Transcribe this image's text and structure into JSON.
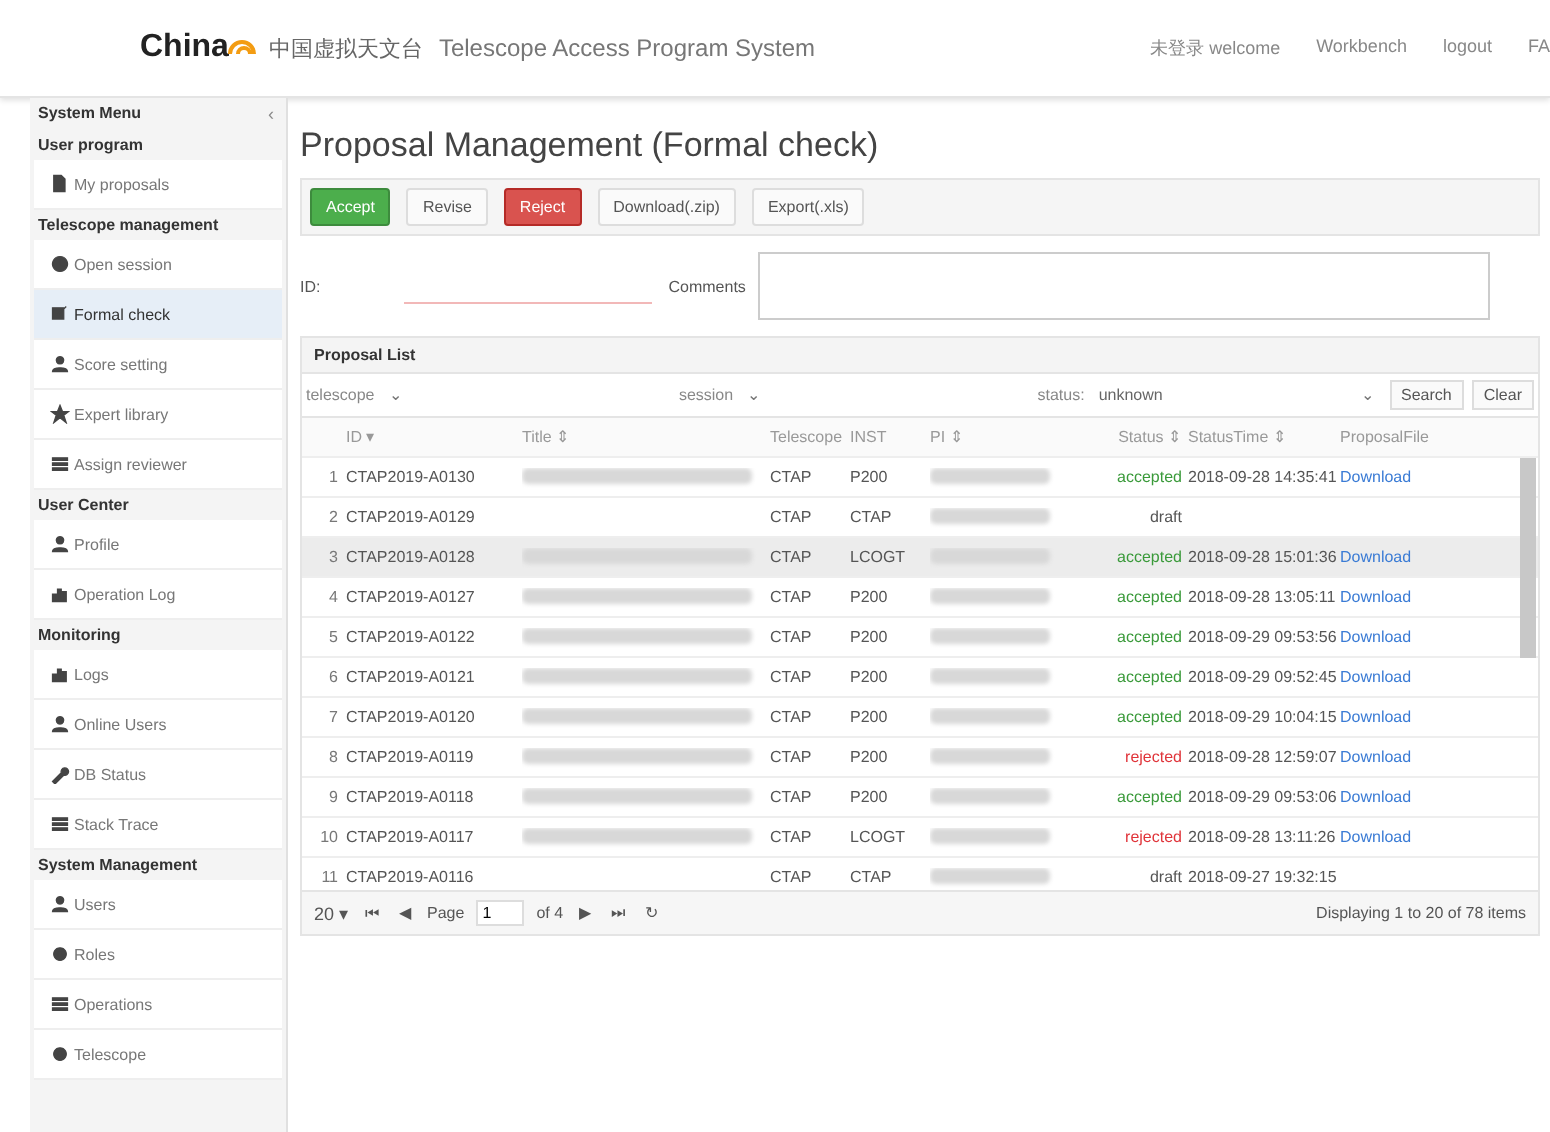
{
  "header": {
    "logo": "China",
    "logo_cn": "中国虚拟天文台",
    "title": "Telescope Access Program System",
    "links": [
      "未登录 welcome",
      "Workbench",
      "logout",
      "FA"
    ]
  },
  "sidebar": {
    "title": "System Menu",
    "collapse": "‹",
    "groups": [
      {
        "label": "User program",
        "items": [
          {
            "label": "My proposals",
            "selected": false
          }
        ]
      },
      {
        "label": "Telescope management",
        "items": [
          {
            "label": "Open session",
            "selected": false
          },
          {
            "label": "Formal check",
            "selected": true
          },
          {
            "label": "Score setting",
            "selected": false
          },
          {
            "label": "Expert library",
            "selected": false
          },
          {
            "label": "Assign reviewer",
            "selected": false
          }
        ]
      },
      {
        "label": "User Center",
        "items": [
          {
            "label": "Profile",
            "selected": false
          },
          {
            "label": "Operation Log",
            "selected": false
          }
        ]
      },
      {
        "label": "Monitoring",
        "items": [
          {
            "label": "Logs",
            "selected": false
          },
          {
            "label": "Online Users",
            "selected": false
          },
          {
            "label": "DB Status",
            "selected": false
          },
          {
            "label": "Stack Trace",
            "selected": false
          }
        ]
      },
      {
        "label": "System Management",
        "items": [
          {
            "label": "Users",
            "selected": false
          },
          {
            "label": "Roles",
            "selected": false
          },
          {
            "label": "Operations",
            "selected": false
          },
          {
            "label": "Telescope",
            "selected": false
          }
        ]
      }
    ]
  },
  "page_title": "Proposal Management (Formal check)",
  "toolbar": [
    {
      "label": "Accept",
      "kind": "accept"
    },
    {
      "label": "Revise",
      "kind": "revise"
    },
    {
      "label": "Reject",
      "kind": "reject"
    },
    {
      "label": "Download(.zip)",
      "kind": "download"
    },
    {
      "label": "Export(.xls)",
      "kind": "export"
    }
  ],
  "form": {
    "id_label": "ID:",
    "comments_label": "Comments"
  },
  "panel_title": "Proposal List",
  "filters": [
    {
      "label": "telescope",
      "caret": "⌄"
    },
    {
      "label": "session",
      "caret": "⌄"
    },
    {
      "label": "status:",
      "value": "unknown",
      "caret": "⌄"
    }
  ],
  "search_button": "Search",
  "clear_button": "Clear",
  "table": {
    "columns": [
      "ID ▾",
      "Title ⇕",
      "Telescope",
      "INST",
      "PI ⇕",
      "Status ⇕",
      "StatusTime ⇕",
      "ProposalFile"
    ],
    "rows": [
      {
        "num": "1",
        "id": "CTAP2019-A0130",
        "title_hidden": true,
        "telescope": "CTAP",
        "inst": "P200",
        "pi_hidden": true,
        "status": "accepted",
        "color": "#3a9a3a",
        "time": "2018-09-28 14:35:41",
        "file": "Download",
        "selected": false
      },
      {
        "num": "2",
        "id": "CTAP2019-A0129",
        "title_hidden": false,
        "telescope": "CTAP",
        "inst": "CTAP",
        "pi_hidden": true,
        "status": "draft",
        "color": "#555555",
        "selected": false
      },
      {
        "num": "3",
        "id": "CTAP2019-A0128",
        "title_hidden": true,
        "telescope": "CTAP",
        "inst": "LCOGT",
        "pi_hidden": true,
        "status": "accepted",
        "color": "#3a9a3a",
        "time": "2018-09-28 15:01:36",
        "file": "Download",
        "selected": true
      },
      {
        "num": "4",
        "id": "CTAP2019-A0127",
        "title_hidden": true,
        "telescope": "CTAP",
        "inst": "P200",
        "pi_hidden": true,
        "status": "accepted",
        "color": "#3a9a3a",
        "time": "2018-09-28 13:05:11",
        "file": "Download",
        "selected": false
      },
      {
        "num": "5",
        "id": "CTAP2019-A0122",
        "title_hidden": true,
        "telescope": "CTAP",
        "inst": "P200",
        "pi_hidden": true,
        "status": "accepted",
        "color": "#3a9a3a",
        "time": "2018-09-29 09:53:56",
        "file": "Download",
        "selected": false
      },
      {
        "num": "6",
        "id": "CTAP2019-A0121",
        "title_hidden": true,
        "telescope": "CTAP",
        "inst": "P200",
        "pi_hidden": true,
        "status": "accepted",
        "color": "#3a9a3a",
        "time": "2018-09-29 09:52:45",
        "file": "Download",
        "selected": false
      },
      {
        "num": "7",
        "id": "CTAP2019-A0120",
        "title_hidden": true,
        "telescope": "CTAP",
        "inst": "P200",
        "pi_hidden": true,
        "status": "accepted",
        "color": "#3a9a3a",
        "time": "2018-09-29 10:04:15",
        "file": "Download",
        "selected": false
      },
      {
        "num": "8",
        "id": "CTAP2019-A0119",
        "title_hidden": true,
        "telescope": "CTAP",
        "inst": "P200",
        "pi_hidden": true,
        "status": "rejected",
        "color": "#e0343a",
        "time": "2018-09-28 12:59:07",
        "file": "Download",
        "selected": false
      },
      {
        "num": "9",
        "id": "CTAP2019-A0118",
        "title_hidden": true,
        "telescope": "CTAP",
        "inst": "P200",
        "pi_hidden": true,
        "status": "accepted",
        "color": "#3a9a3a",
        "time": "2018-09-29 09:53:06",
        "file": "Download",
        "selected": false
      },
      {
        "num": "10",
        "id": "CTAP2019-A0117",
        "title_hidden": true,
        "telescope": "CTAP",
        "inst": "LCOGT",
        "pi_hidden": true,
        "status": "rejected",
        "color": "#e0343a",
        "time": "2018-09-28 13:11:26",
        "file": "Download",
        "selected": false
      },
      {
        "num": "11",
        "id": "CTAP2019-A0116",
        "title_hidden": false,
        "telescope": "CTAP",
        "inst": "CTAP",
        "pi_hidden": true,
        "status": "draft",
        "color": "#555555",
        "time": "2018-09-27 19:32:15",
        "selected": false
      }
    ]
  },
  "pager": {
    "size": "20 ▾",
    "first": "⏮",
    "prev": "◀",
    "page_label": "Page",
    "page": "1",
    "of": "of 4",
    "next": "▶",
    "last": "⏭",
    "refresh": "↻",
    "summary": "Displaying 1 to 20 of 78 items"
  }
}
